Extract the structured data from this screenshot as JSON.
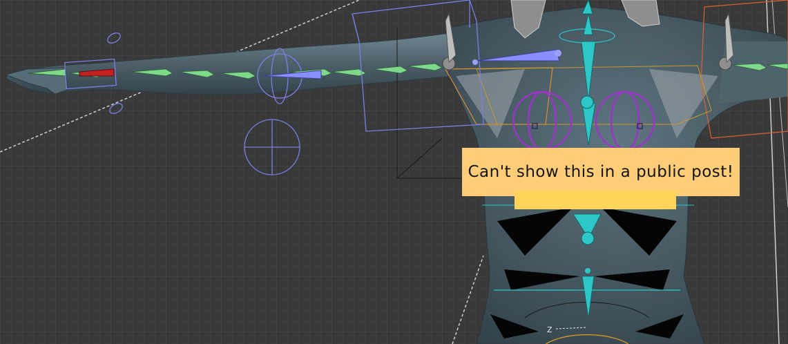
{
  "viewport": {
    "background_color": "#393939",
    "grid_color": "#454545",
    "axis_label": "Z"
  },
  "model": {
    "skin_color": "#4a5c66",
    "skin_highlight": "#6f8590",
    "hair_color": "#8c8c8c"
  },
  "armature": {
    "arm_bone_color": "#7fd98a",
    "spine_bone_color": "#2ec7c7",
    "ik_control_color": "#7b7fe6",
    "breast_control_color": "#9a35c8",
    "shoulder_control_color": "#e08a2c",
    "hand_target_color": "#c42020"
  },
  "censor": {
    "text": "Can't show this in a public post!",
    "banner_color": "#ffcc77",
    "strip_color": "#ffd45a"
  }
}
